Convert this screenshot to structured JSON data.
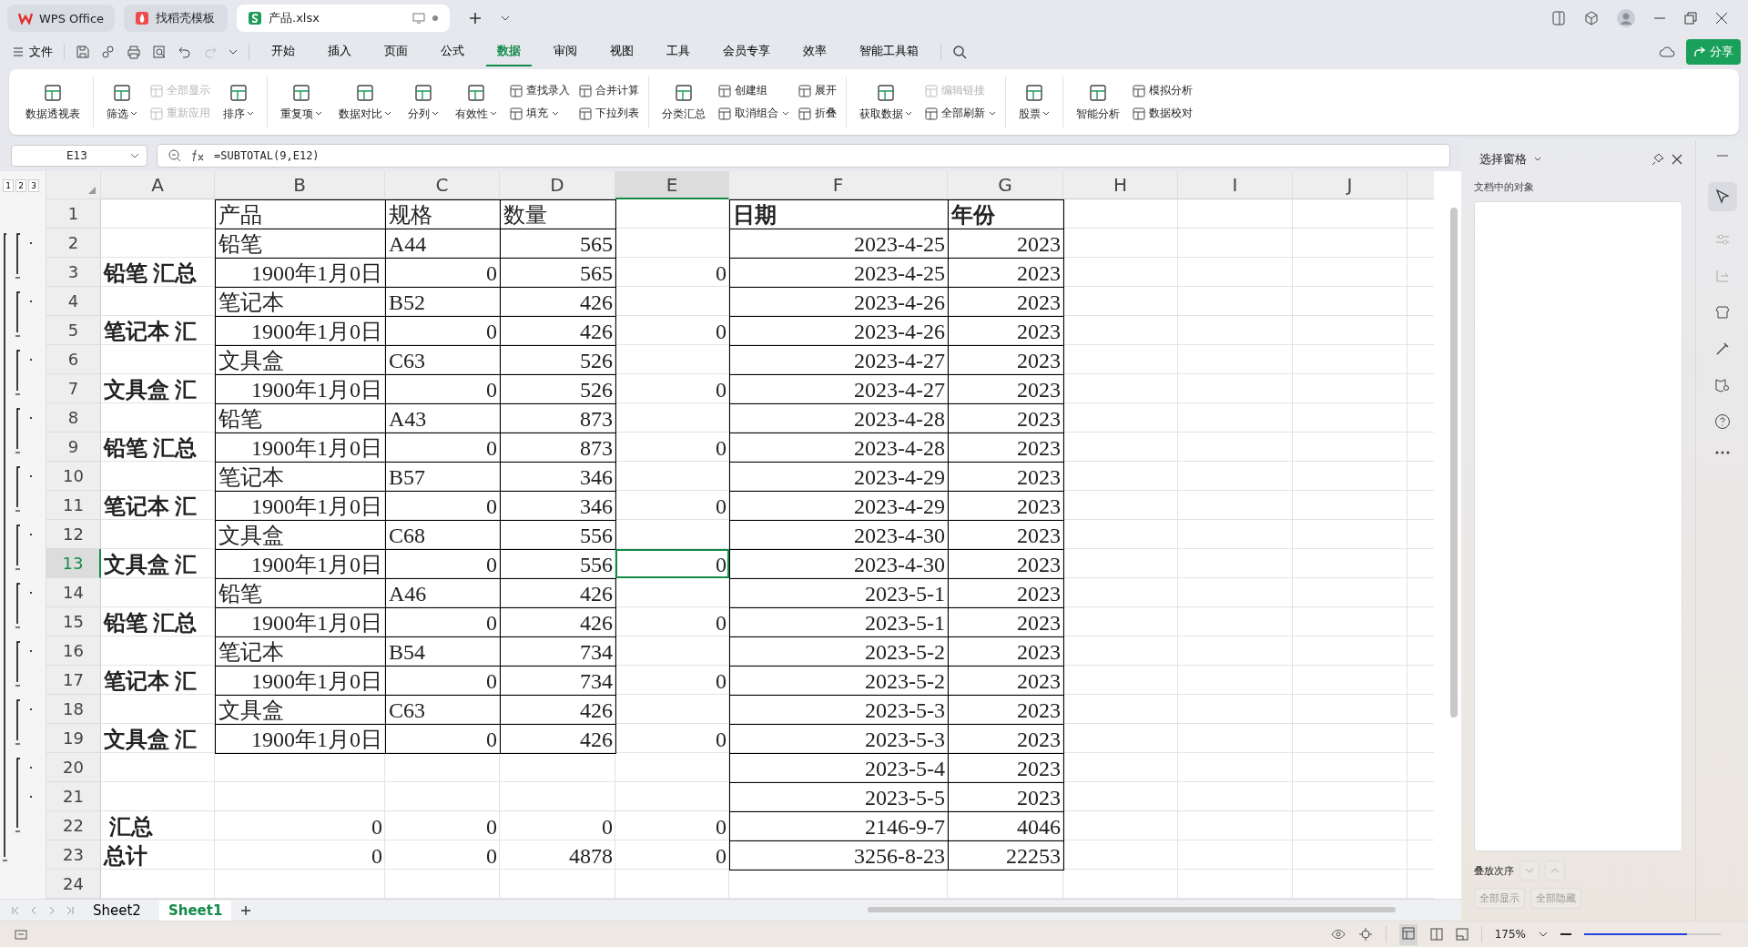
{
  "title_tabs": [
    {
      "label": "WPS Office",
      "kind": "wps",
      "selected": false
    },
    {
      "label": "找稻壳模板",
      "kind": "template",
      "selected": false
    },
    {
      "label": "产品.xlsx",
      "kind": "sheet",
      "selected": true
    }
  ],
  "menu": {
    "file": "文件",
    "tabs": [
      {
        "label": "开始",
        "selected": false
      },
      {
        "label": "插入",
        "selected": false
      },
      {
        "label": "页面",
        "selected": false
      },
      {
        "label": "公式",
        "selected": false
      },
      {
        "label": "数据",
        "selected": true
      },
      {
        "label": "审阅",
        "selected": false
      },
      {
        "label": "视图",
        "selected": false
      },
      {
        "label": "工具",
        "selected": false
      },
      {
        "label": "会员专享",
        "selected": false
      },
      {
        "label": "效率",
        "selected": false
      },
      {
        "label": "智能工具箱",
        "selected": false
      }
    ],
    "share": "分享"
  },
  "ribbon": [
    [
      {
        "kind": "large",
        "label": "数据透视表",
        "dropdown": false,
        "disabled": false
      }
    ],
    [
      {
        "kind": "large",
        "label": "筛选",
        "dropdown": true,
        "disabled": false
      },
      {
        "kind": "stack",
        "items": [
          {
            "label": "全部显示",
            "dropdown": false,
            "disabled": true
          },
          {
            "label": "重新应用",
            "dropdown": false,
            "disabled": true
          }
        ]
      },
      {
        "kind": "large",
        "label": "排序",
        "dropdown": true,
        "disabled": false
      }
    ],
    [
      {
        "kind": "large",
        "label": "重复项",
        "dropdown": true,
        "disabled": false
      },
      {
        "kind": "large",
        "label": "数据对比",
        "dropdown": true,
        "disabled": false
      },
      {
        "kind": "large",
        "label": "分列",
        "dropdown": true,
        "disabled": false
      },
      {
        "kind": "large",
        "label": "有效性",
        "dropdown": true,
        "disabled": false
      },
      {
        "kind": "stack",
        "items": [
          {
            "label": "查找录入",
            "dropdown": false,
            "disabled": false
          },
          {
            "label": "填充",
            "dropdown": true,
            "disabled": false
          }
        ]
      },
      {
        "kind": "stack",
        "items": [
          {
            "label": "合并计算",
            "dropdown": false,
            "disabled": false
          },
          {
            "label": "下拉列表",
            "dropdown": false,
            "disabled": false
          }
        ]
      }
    ],
    [
      {
        "kind": "large",
        "label": "分类汇总",
        "dropdown": false,
        "disabled": false
      },
      {
        "kind": "stack",
        "items": [
          {
            "label": "创建组",
            "dropdown": false,
            "disabled": false
          },
          {
            "label": "取消组合",
            "dropdown": true,
            "disabled": false
          }
        ]
      },
      {
        "kind": "stack",
        "items": [
          {
            "label": "展开",
            "dropdown": false,
            "disabled": false
          },
          {
            "label": "折叠",
            "dropdown": false,
            "disabled": false
          }
        ]
      }
    ],
    [
      {
        "kind": "large",
        "label": "获取数据",
        "dropdown": true,
        "disabled": false
      },
      {
        "kind": "stack",
        "items": [
          {
            "label": "编辑链接",
            "dropdown": false,
            "disabled": true
          },
          {
            "label": "全部刷新",
            "dropdown": true,
            "disabled": false
          }
        ]
      }
    ],
    [
      {
        "kind": "large",
        "label": "股票",
        "dropdown": true,
        "disabled": false
      }
    ],
    [
      {
        "kind": "large",
        "label": "智能分析",
        "dropdown": false,
        "disabled": false
      },
      {
        "kind": "stack",
        "items": [
          {
            "label": "模拟分析",
            "dropdown": false,
            "disabled": false
          },
          {
            "label": "数据校对",
            "dropdown": false,
            "disabled": false
          }
        ]
      }
    ]
  ],
  "formula_bar": {
    "name_box": "E13",
    "formula": "=SUBTOTAL(9,E12)"
  },
  "outline_levels": [
    "1",
    "2",
    "3"
  ],
  "sheet": {
    "columns": [
      {
        "label": "A",
        "selected": false
      },
      {
        "label": "B",
        "selected": false
      },
      {
        "label": "C",
        "selected": false
      },
      {
        "label": "D",
        "selected": false
      },
      {
        "label": "E",
        "selected": true
      },
      {
        "label": "F",
        "selected": false
      },
      {
        "label": "G",
        "selected": false
      },
      {
        "label": "H",
        "selected": false
      },
      {
        "label": "I",
        "selected": false
      },
      {
        "label": "J",
        "selected": false
      }
    ],
    "rows": [
      {
        "number": "1",
        "selected": false,
        "cells": {
          "b": "产品",
          "c": "规格",
          "d": "数量",
          "f": "日期",
          "g": "年份"
        }
      },
      {
        "number": "2",
        "selected": false,
        "cells": {
          "b": "铅笔",
          "c": "A44",
          "d": "565",
          "f": "2023-4-25",
          "g": "2023"
        }
      },
      {
        "number": "3",
        "selected": false,
        "cells": {
          "a": "铅笔 汇总",
          "b": "1900年1月0日",
          "c": "0",
          "d": "565",
          "e": "0",
          "f": "2023-4-25",
          "g": "2023"
        }
      },
      {
        "number": "4",
        "selected": false,
        "cells": {
          "b": "笔记本",
          "c": "B52",
          "d": "426",
          "f": "2023-4-26",
          "g": "2023"
        }
      },
      {
        "number": "5",
        "selected": false,
        "cells": {
          "a": "笔记本 汇",
          "b": "1900年1月0日",
          "c": "0",
          "d": "426",
          "e": "0",
          "f": "2023-4-26",
          "g": "2023"
        }
      },
      {
        "number": "6",
        "selected": false,
        "cells": {
          "b": "文具盒",
          "c": "C63",
          "d": "526",
          "f": "2023-4-27",
          "g": "2023"
        }
      },
      {
        "number": "7",
        "selected": false,
        "cells": {
          "a": "文具盒 汇",
          "b": "1900年1月0日",
          "c": "0",
          "d": "526",
          "e": "0",
          "f": "2023-4-27",
          "g": "2023"
        }
      },
      {
        "number": "8",
        "selected": false,
        "cells": {
          "b": "铅笔",
          "c": "A43",
          "d": "873",
          "f": "2023-4-28",
          "g": "2023"
        }
      },
      {
        "number": "9",
        "selected": false,
        "cells": {
          "a": "铅笔 汇总",
          "b": "1900年1月0日",
          "c": "0",
          "d": "873",
          "e": "0",
          "f": "2023-4-28",
          "g": "2023"
        }
      },
      {
        "number": "10",
        "selected": false,
        "cells": {
          "b": "笔记本",
          "c": "B57",
          "d": "346",
          "f": "2023-4-29",
          "g": "2023"
        }
      },
      {
        "number": "11",
        "selected": false,
        "cells": {
          "a": "笔记本 汇",
          "b": "1900年1月0日",
          "c": "0",
          "d": "346",
          "e": "0",
          "f": "2023-4-29",
          "g": "2023"
        }
      },
      {
        "number": "12",
        "selected": false,
        "cells": {
          "b": "文具盒",
          "c": "C68",
          "d": "556",
          "f": "2023-4-30",
          "g": "2023"
        }
      },
      {
        "number": "13",
        "selected": true,
        "cells": {
          "a": "文具盒 汇",
          "b": "1900年1月0日",
          "c": "0",
          "d": "556",
          "e": "0",
          "f": "2023-4-30",
          "g": "2023"
        }
      },
      {
        "number": "14",
        "selected": false,
        "cells": {
          "b": "铅笔",
          "c": "A46",
          "d": "426",
          "f": "2023-5-1",
          "g": "2023"
        }
      },
      {
        "number": "15",
        "selected": false,
        "cells": {
          "a": "铅笔 汇总",
          "b": "1900年1月0日",
          "c": "0",
          "d": "426",
          "e": "0",
          "f": "2023-5-1",
          "g": "2023"
        }
      },
      {
        "number": "16",
        "selected": false,
        "cells": {
          "b": "笔记本",
          "c": "B54",
          "d": "734",
          "f": "2023-5-2",
          "g": "2023"
        }
      },
      {
        "number": "17",
        "selected": false,
        "cells": {
          "a": "笔记本 汇",
          "b": "1900年1月0日",
          "c": "0",
          "d": "734",
          "e": "0",
          "f": "2023-5-2",
          "g": "2023"
        }
      },
      {
        "number": "18",
        "selected": false,
        "cells": {
          "b": "文具盒",
          "c": "C63",
          "d": "426",
          "f": "2023-5-3",
          "g": "2023"
        }
      },
      {
        "number": "19",
        "selected": false,
        "cells": {
          "a": "文具盒 汇",
          "b": "1900年1月0日",
          "c": "0",
          "d": "426",
          "e": "0",
          "f": "2023-5-3",
          "g": "2023"
        }
      },
      {
        "number": "20",
        "selected": false,
        "cells": {
          "f": "2023-5-4",
          "g": "2023"
        }
      },
      {
        "number": "21",
        "selected": false,
        "cells": {
          "f": "2023-5-5",
          "g": "2023"
        }
      },
      {
        "number": "22",
        "selected": false,
        "cells": {
          "a": " 汇总",
          "b": "0",
          "c": "0",
          "d": "0",
          "e": "0",
          "f": "2146-9-7",
          "g": "4046"
        }
      },
      {
        "number": "23",
        "selected": false,
        "cells": {
          "a": "总计",
          "b": "0",
          "c": "0",
          "d": "4878",
          "e": "0",
          "f": "3256-8-23",
          "g": "22253"
        }
      },
      {
        "number": "24",
        "selected": false,
        "cells": {}
      }
    ]
  },
  "sheet_tabs": [
    {
      "label": "Sheet2",
      "selected": false
    },
    {
      "label": "Sheet1",
      "selected": true
    }
  ],
  "selection_pane": {
    "title": "选择窗格",
    "subtitle": "文档中的对象",
    "order_label": "叠放次序",
    "buttons": [
      "全部显示",
      "全部隐藏"
    ]
  },
  "status_bar": {
    "zoom": "175%",
    "zoom_slider": {
      "level": 0.75
    }
  }
}
